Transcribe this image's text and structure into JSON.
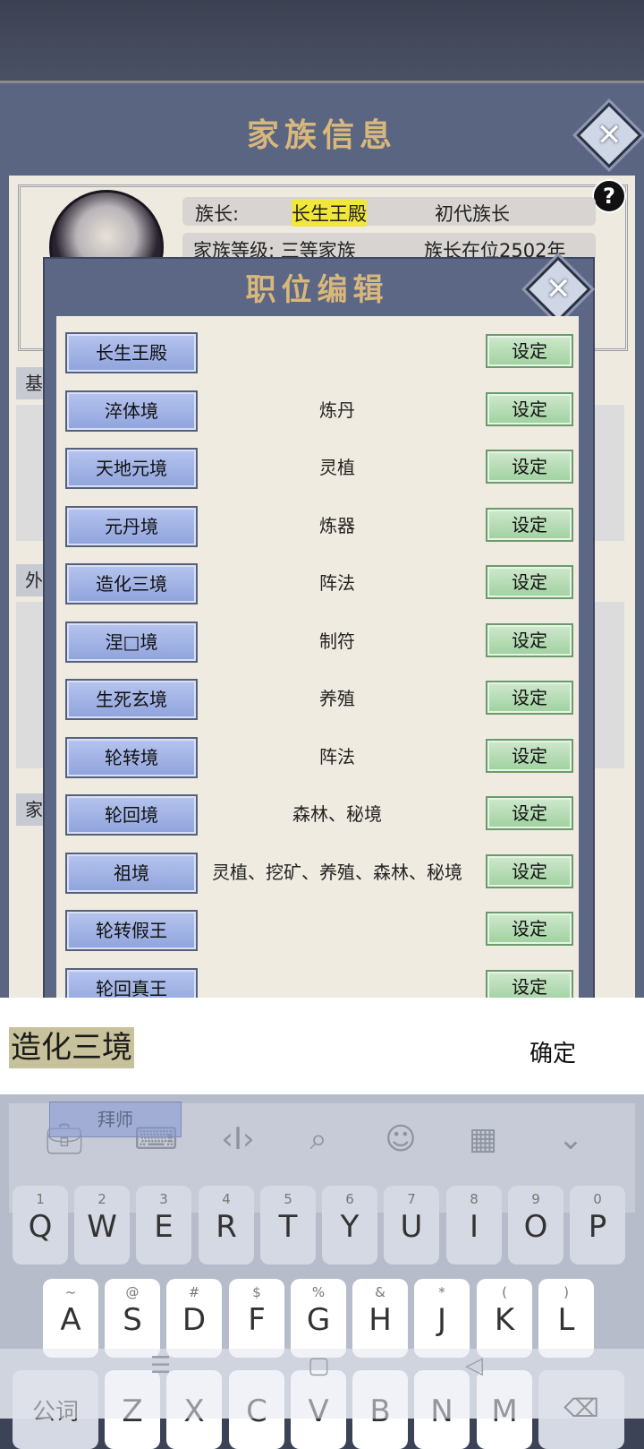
{
  "family_panel": {
    "title": "家族信息",
    "row1": {
      "label": "族长:",
      "name": "长生王殿",
      "generation": "初代族长"
    },
    "row2": {
      "level": "家族等级: 三等家族",
      "tenure": "族长在位2502年"
    },
    "side_labels": [
      "基",
      "外",
      "家"
    ],
    "help": "?"
  },
  "position_editor": {
    "title": "职位编辑",
    "set_label": "设定",
    "rows": [
      {
        "realm": "长生王殿",
        "duty": ""
      },
      {
        "realm": "淬体境",
        "duty": "炼丹"
      },
      {
        "realm": "天地元境",
        "duty": "灵植"
      },
      {
        "realm": "元丹境",
        "duty": "炼器"
      },
      {
        "realm": "造化三境",
        "duty": "阵法"
      },
      {
        "realm": "涅□境",
        "duty": "制符"
      },
      {
        "realm": "生死玄境",
        "duty": "养殖"
      },
      {
        "realm": "轮转境",
        "duty": "阵法"
      },
      {
        "realm": "轮回境",
        "duty": "森林、秘境"
      },
      {
        "realm": "祖境",
        "duty": "灵植、挖矿、养殖、森林、秘境"
      },
      {
        "realm": "轮转假王",
        "duty": ""
      },
      {
        "realm": "轮回真王",
        "duty": ""
      }
    ]
  },
  "input_bar": {
    "value": "造化三境",
    "confirm": "确定"
  },
  "keyboard": {
    "overlay_button": "拜师",
    "row1": [
      {
        "num": "1",
        "ch": "Q"
      },
      {
        "num": "2",
        "ch": "W"
      },
      {
        "num": "3",
        "ch": "E"
      },
      {
        "num": "4",
        "ch": "R"
      },
      {
        "num": "5",
        "ch": "T"
      },
      {
        "num": "6",
        "ch": "Y"
      },
      {
        "num": "7",
        "ch": "U"
      },
      {
        "num": "8",
        "ch": "I"
      },
      {
        "num": "9",
        "ch": "O"
      },
      {
        "num": "0",
        "ch": "P"
      }
    ],
    "row2": [
      {
        "num": "~",
        "ch": "A"
      },
      {
        "num": "@",
        "ch": "S"
      },
      {
        "num": "#",
        "ch": "D"
      },
      {
        "num": "$",
        "ch": "F"
      },
      {
        "num": "%",
        "ch": "G"
      },
      {
        "num": "&",
        "ch": "H"
      },
      {
        "num": "*",
        "ch": "J"
      },
      {
        "num": "(",
        "ch": "K"
      },
      {
        "num": ")",
        "ch": "L"
      }
    ],
    "row3": [
      {
        "num": "",
        "ch": "公词"
      },
      {
        "num": "",
        "ch": "Z"
      },
      {
        "num": "",
        "ch": "X"
      },
      {
        "num": "",
        "ch": "C"
      },
      {
        "num": "",
        "ch": "V"
      },
      {
        "num": "",
        "ch": "B"
      },
      {
        "num": "",
        "ch": "N"
      },
      {
        "num": "",
        "ch": "M"
      }
    ],
    "toolbar_icons": [
      "briefcase-icon",
      "keyboard-icon",
      "cursor-icon",
      "search-icon",
      "emoji-icon",
      "grid-icon",
      "chevron-down-icon"
    ]
  }
}
